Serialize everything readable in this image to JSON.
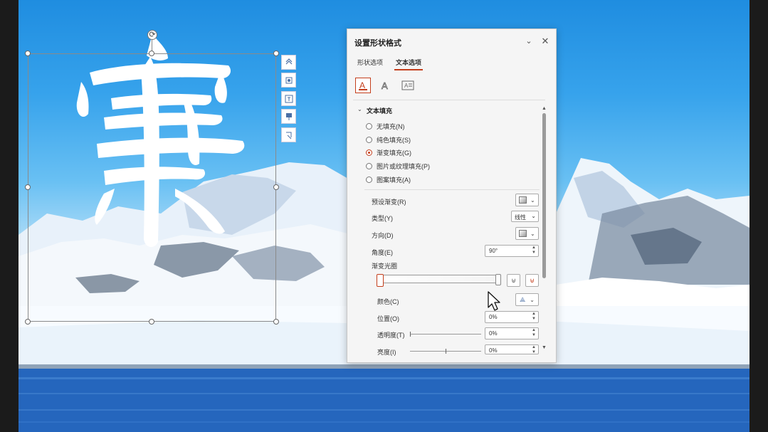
{
  "panel": {
    "title": "设置形状格式",
    "tabs": [
      {
        "label": "形状选项",
        "active": false
      },
      {
        "label": "文本选项",
        "active": true
      }
    ],
    "subtabs": [
      "text-fill-outline-icon",
      "text-effects-icon",
      "textbox-icon"
    ],
    "section": {
      "label": "文本填充",
      "fill_options": [
        {
          "label": "无填充(N)",
          "selected": false
        },
        {
          "label": "纯色填充(S)",
          "selected": false
        },
        {
          "label": "渐变填充(G)",
          "selected": true
        },
        {
          "label": "图片或纹理填充(P)",
          "selected": false
        },
        {
          "label": "图案填充(A)",
          "selected": false
        }
      ],
      "preset_gradient": {
        "label": "预设渐变(R)"
      },
      "type": {
        "label": "类型(Y)",
        "value": "线性"
      },
      "direction": {
        "label": "方向(D)"
      },
      "angle": {
        "label": "角度(E)",
        "value": "90°"
      },
      "gradient_stops": {
        "label": "渐变光圈"
      },
      "color": {
        "label": "颜色(C)"
      },
      "position": {
        "label": "位置(O)",
        "value": "0%"
      },
      "transparency": {
        "label": "透明度(T)",
        "value": "0%",
        "level": 0
      },
      "brightness": {
        "label": "亮度(I)",
        "value": "0%",
        "level": 0.5
      }
    }
  },
  "slide": {
    "text_art": "寨",
    "colors": {
      "sky_top": "#1f8de0",
      "snow": "#ffffff",
      "water": "#2a72c6"
    }
  },
  "colors": {
    "accent": "#c43e1c",
    "panel_bg": "#f5f5f5"
  }
}
